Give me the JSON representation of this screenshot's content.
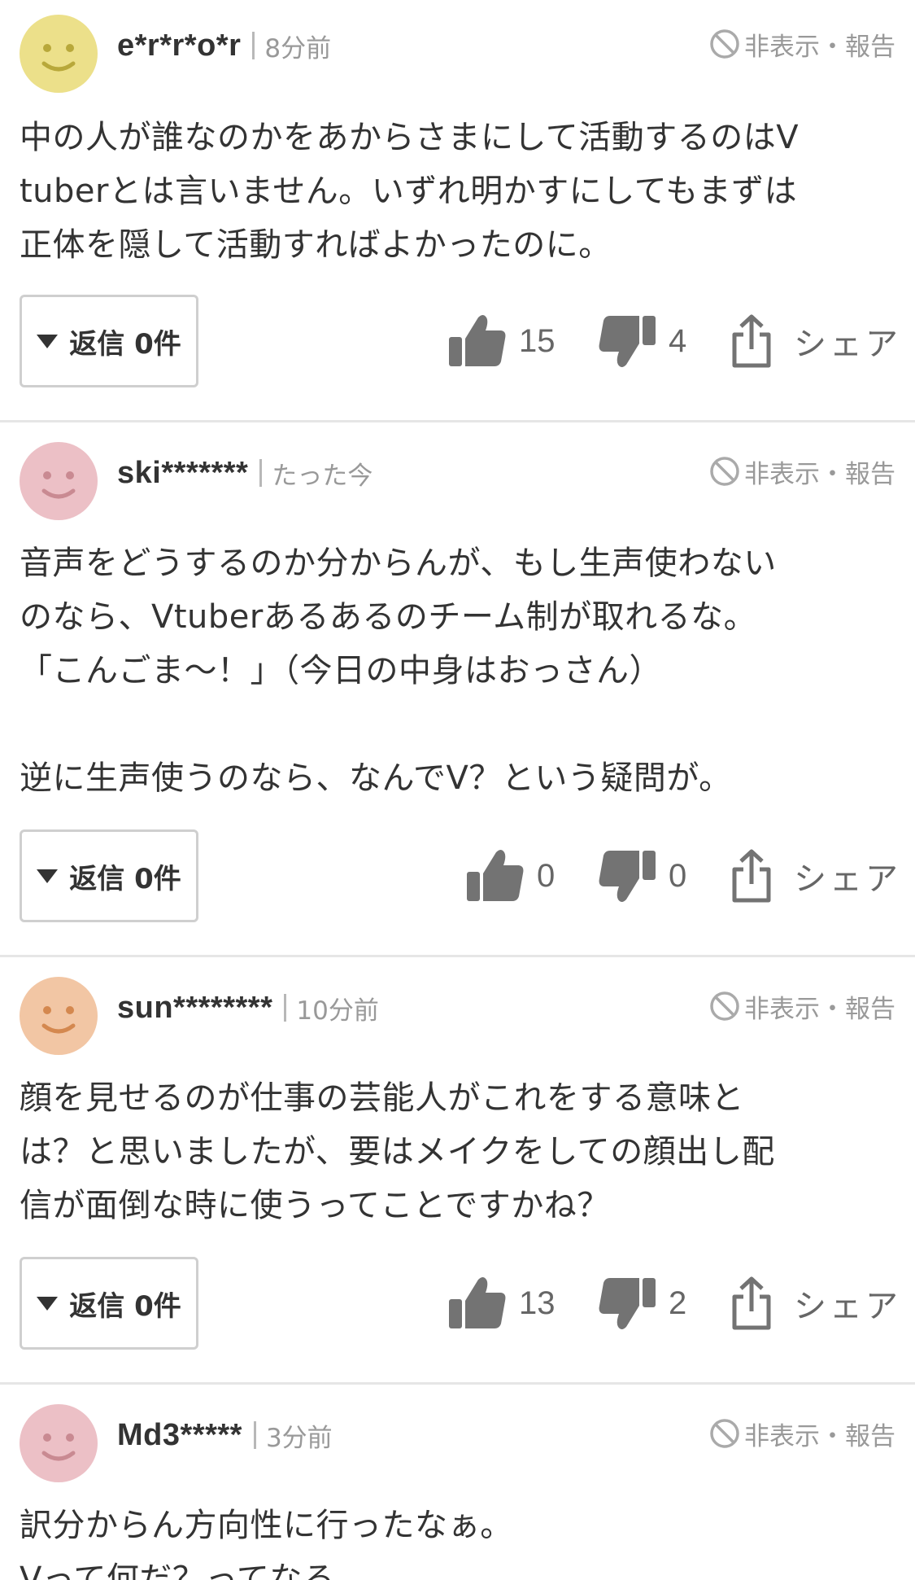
{
  "labels": {
    "report": "非表示・報告",
    "reply": "返信 0件",
    "share": "シェア"
  },
  "colors": {
    "avatar_yellow": "#ece08a",
    "avatar_pink": "#ecc0c6",
    "avatar_orange": "#f2c6a4",
    "text": "#333333",
    "muted": "#999999",
    "icon": "#737373"
  },
  "comments": [
    {
      "user": "e*r*r*o*r",
      "time": "8分前",
      "avatar_color": "avatar_yellow",
      "text": "中の人が誰なのかをあからさまにして活動するのはV\ntuberとは言いません。いずれ明かすにしてもまずは\n正体を隠して活動すればよかったのに。",
      "likes": "15",
      "dislikes": "4"
    },
    {
      "user": "ski*******",
      "time": "たった今",
      "avatar_color": "avatar_pink",
      "text": "音声をどうするのか分からんが、もし生声使わない\nのなら、Vtuberあるあるのチーム制が取れるな。\n「こんごま～！」（今日の中身はおっさん）\n\n逆に生声使うのなら、なんでV？という疑問が。",
      "likes": "0",
      "dislikes": "0"
    },
    {
      "user": "sun********",
      "time": "10分前",
      "avatar_color": "avatar_orange",
      "text": "顔を見せるのが仕事の芸能人がこれをする意味と\nは？と思いましたが、要はメイクをしての顔出し配\n信が面倒な時に使うってことですかね？",
      "likes": "13",
      "dislikes": "2"
    },
    {
      "user": "Md3*****",
      "time": "3分前",
      "avatar_color": "avatar_pink",
      "text": "訳分からん方向性に行ったなぁ。\nVって何だ？ってなる。"
    }
  ]
}
